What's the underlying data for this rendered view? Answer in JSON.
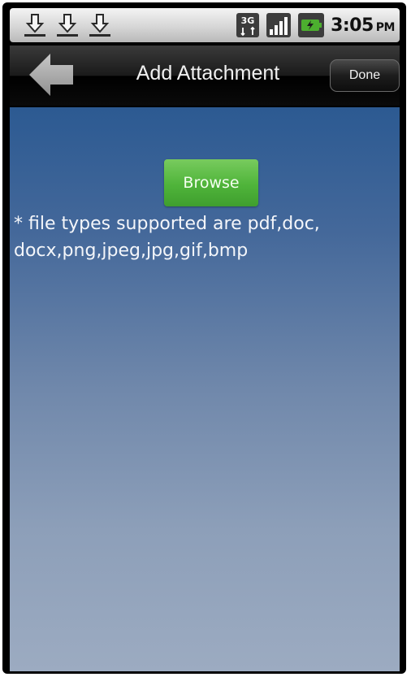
{
  "status_bar": {
    "icons": [
      "download-icon",
      "download-icon",
      "download-icon",
      "3g-icon",
      "signal-icon",
      "battery-icon"
    ],
    "network_label": "3G",
    "time": "3:05",
    "ampm": "PM"
  },
  "header": {
    "back_icon": "back-arrow-icon",
    "title": "Add Attachment",
    "done_label": "Done"
  },
  "main": {
    "browse_label": "Browse",
    "supported_note": "* file types supported are pdf,doc,\ndocx,png,jpeg,jpg,gif,bmp"
  },
  "colors": {
    "browse_button": "#4fb43a",
    "content_top": "#2c5a92",
    "content_bottom": "#9cabc1"
  }
}
